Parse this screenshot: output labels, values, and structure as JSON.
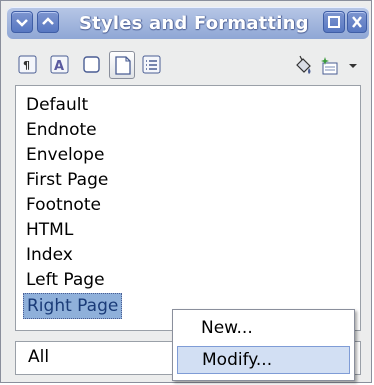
{
  "window": {
    "title": "Styles and Formatting",
    "accent": "#8fa7d5"
  },
  "titlebar_buttons": {
    "menu_icon": "chevron-down-icon",
    "shade_icon": "arrow-up-icon",
    "maximize_icon": "maximize-icon",
    "close_icon": "close-icon"
  },
  "toolbar": {
    "icons": [
      "paragraph-styles-icon",
      "character-styles-icon",
      "frame-styles-icon",
      "page-styles-icon",
      "list-styles-icon",
      "fill-format-mode-icon",
      "new-style-from-selection-icon",
      "dropdown-arrow-icon"
    ],
    "active_icon": "page-styles-icon"
  },
  "styles_list": {
    "items": [
      "Default",
      "Endnote",
      "Envelope",
      "First Page",
      "Footnote",
      "HTML",
      "Index",
      "Left Page",
      "Right Page"
    ],
    "selected": "Right Page",
    "selection_color": "#8fb0da"
  },
  "filter": {
    "selected": "All"
  },
  "context_menu": {
    "items": [
      "New...",
      "Modify..."
    ],
    "highlighted": "Modify..."
  }
}
